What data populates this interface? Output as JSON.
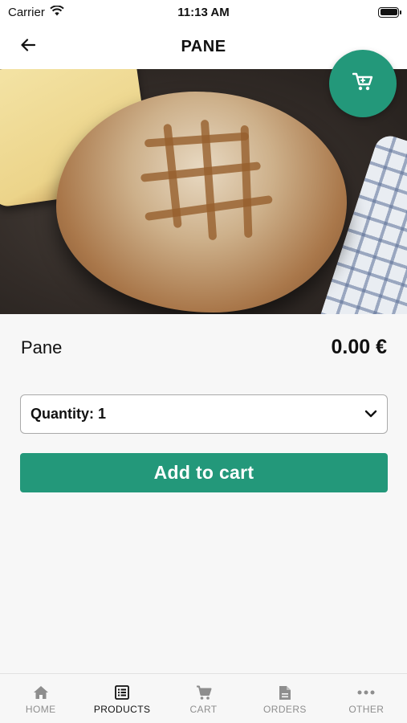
{
  "status_bar": {
    "carrier": "Carrier",
    "time": "11:13 AM"
  },
  "nav": {
    "title": "PANE"
  },
  "product": {
    "name": "Pane",
    "price": "0.00 €",
    "carousel": {
      "total_images": 1,
      "active_index": 0
    }
  },
  "quantity": {
    "label": "Quantity: 1"
  },
  "actions": {
    "add_to_cart": "Add to cart"
  },
  "tabs": [
    {
      "label": "HOME",
      "icon": "home-icon",
      "active": false
    },
    {
      "label": "PRODUCTS",
      "icon": "list-icon",
      "active": true
    },
    {
      "label": "CART",
      "icon": "cart-icon",
      "active": false
    },
    {
      "label": "ORDERS",
      "icon": "document-icon",
      "active": false
    },
    {
      "label": "OTHER",
      "icon": "more-icon",
      "active": false
    }
  ],
  "colors": {
    "accent": "#23987a",
    "inactive_tab": "#8e8e8e",
    "active_tab": "#111111"
  }
}
